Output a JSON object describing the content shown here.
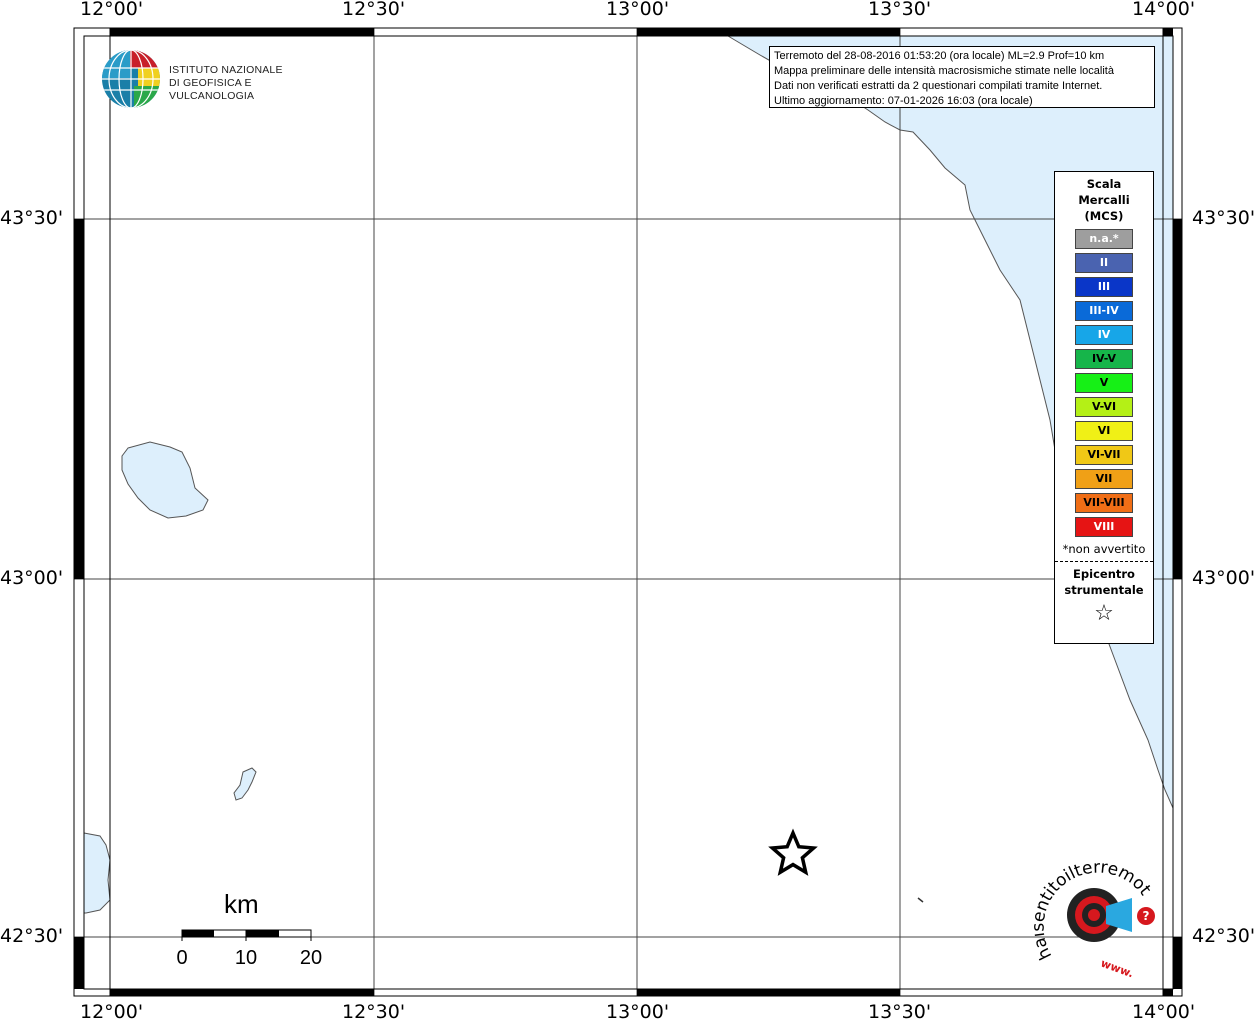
{
  "info_box": {
    "line1": "Terremoto del 28-08-2016 01:53:20 (ora locale) ML=2.9 Prof=10 km",
    "line2": "Mappa preliminare delle intensità macrosismiche stimate nelle località",
    "line3": "Dati non verificati estratti da 2 questionari compilati tramite Internet.",
    "line4": "Ultimo aggiornamento: 07-01-2026 16:03 (ora locale)"
  },
  "logo_ingv": {
    "line1": "ISTITUTO NAZIONALE",
    "line2": "DI GEOFISICA E VULCANOLOGIA"
  },
  "logo_hsit": {
    "text": "haisentitoilterremoto.it",
    "prefix": "www."
  },
  "axes": {
    "longitude_labels": [
      "12°00'",
      "12°30'",
      "13°00'",
      "13°30'",
      "14°00'"
    ],
    "latitude_labels": [
      "43°30'",
      "43°00'",
      "42°30'"
    ]
  },
  "scale_bar": {
    "unit": "km",
    "ticks": [
      "0",
      "10",
      "20"
    ]
  },
  "legend": {
    "title_line1": "Scala",
    "title_line2": "Mercalli",
    "title_line3": "(MCS)",
    "items": [
      {
        "label": "n.a.*",
        "color": "#9e9e9e",
        "text_color": "#ffffff"
      },
      {
        "label": "II",
        "color": "#4a63b0",
        "text_color": "#ffffff"
      },
      {
        "label": "III",
        "color": "#0a36c8",
        "text_color": "#ffffff"
      },
      {
        "label": "III-IV",
        "color": "#0a6ad8",
        "text_color": "#ffffff"
      },
      {
        "label": "IV",
        "color": "#17a6e8",
        "text_color": "#ffffff"
      },
      {
        "label": "IV-V",
        "color": "#16b54a",
        "text_color": "#000000"
      },
      {
        "label": "V",
        "color": "#16f016",
        "text_color": "#000000"
      },
      {
        "label": "V-VI",
        "color": "#b4f016",
        "text_color": "#000000"
      },
      {
        "label": "VI",
        "color": "#f0f016",
        "text_color": "#000000"
      },
      {
        "label": "VI-VII",
        "color": "#f0c816",
        "text_color": "#000000"
      },
      {
        "label": "VII",
        "color": "#f0a016",
        "text_color": "#000000"
      },
      {
        "label": "VII-VIII",
        "color": "#f06e16",
        "text_color": "#000000"
      },
      {
        "label": "VIII",
        "color": "#e61414",
        "text_color": "#ffffff"
      }
    ],
    "note": "*non avvertito",
    "epicenter_line1": "Epicentro",
    "epicenter_line2": "strumentale",
    "epicenter_symbol": "☆"
  },
  "colors": {
    "water": "#ddeffc",
    "coast": "#555555",
    "grid": "#444444"
  }
}
